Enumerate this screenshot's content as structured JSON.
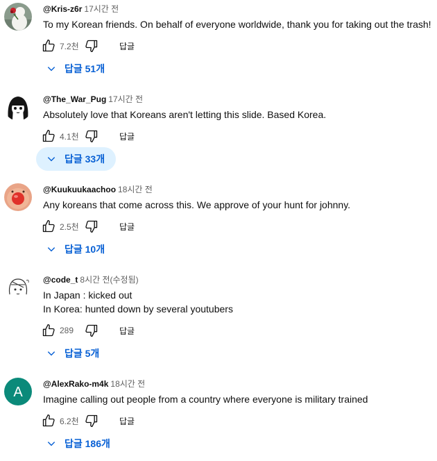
{
  "reply_label": "답글",
  "comments": [
    {
      "author": "@Kris-z6r",
      "time": "17시간 전",
      "text": [
        "To my Korean friends. On behalf of everyone worldwide, thank you for taking out the trash!"
      ],
      "likes": "7.2천",
      "replies": "답글 51개",
      "avatar": "portrait-red-rose-avatar"
    },
    {
      "author": "@The_War_Pug",
      "time": "17시간 전",
      "text": [
        "Absolutely love that Koreans aren't letting this slide. Based Korea."
      ],
      "likes": "4.1천",
      "replies": "답글 33개",
      "avatar": "anime-girl-avatar"
    },
    {
      "author": "@Kuukuukaachoo",
      "time": "18시간 전",
      "text": [
        "Any koreans that come across this. We approve of your hunt for johnny."
      ],
      "likes": "2.5천",
      "replies": "답글 10개",
      "avatar": "red-nose-face-avatar"
    },
    {
      "author": "@code_t",
      "time": "8시간 전(수정됨)",
      "text": [
        "In Japan : kicked out",
        "In Korea: hunted down by several youtubers"
      ],
      "likes": "289",
      "replies": "답글 5개",
      "avatar": "sketch-character-avatar"
    },
    {
      "author": "@AlexRako-m4k",
      "time": "18시간 전",
      "text": [
        "Imagine calling out people from a country where everyone is military trained"
      ],
      "likes": "6.2천",
      "replies": "답글 186개",
      "avatar": "letter-a-avatar",
      "avatar_letter": "A"
    }
  ],
  "colors": {
    "link_blue": "#065fd4",
    "hover_bg": "#def1ff",
    "muted": "#606060",
    "avatar_teal": "#0b8a7a"
  }
}
